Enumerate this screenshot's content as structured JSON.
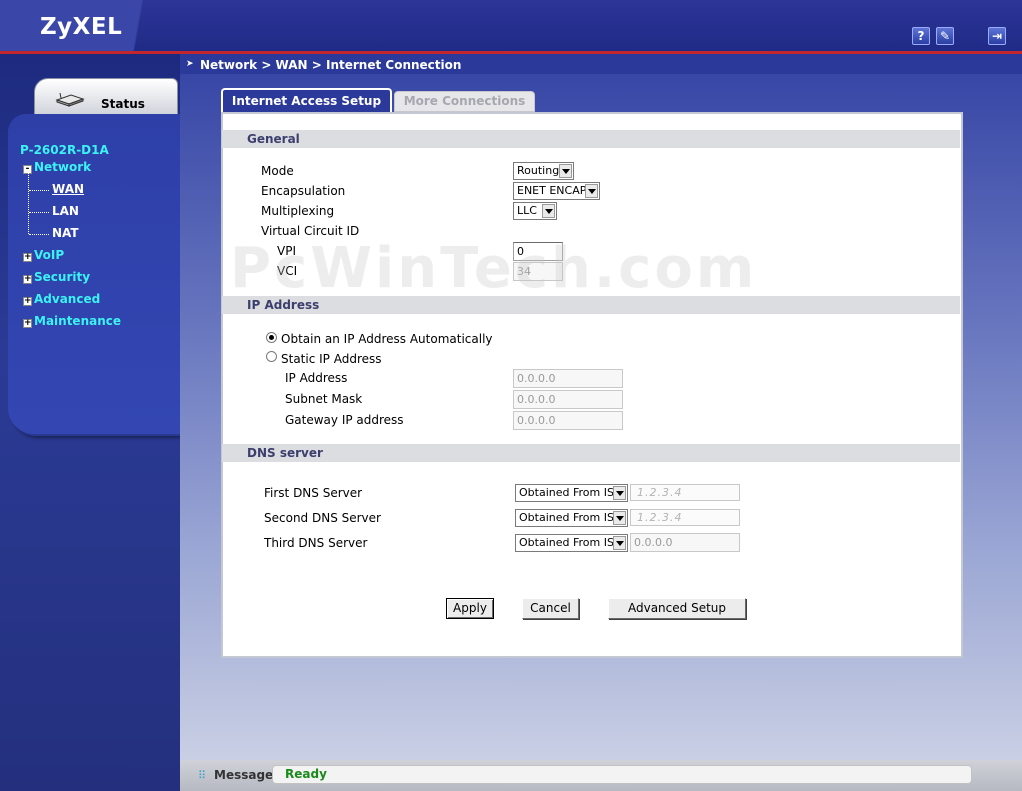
{
  "header": {
    "logo": "ZyXEL",
    "help_icon_label": "?",
    "wizard_icon_label": "✎",
    "logout_icon_label": "⇥"
  },
  "sidebar": {
    "status_label": "Status",
    "device_name": "P-2602R-D1A",
    "items": [
      {
        "label": "Network",
        "toggle": "-"
      },
      {
        "label": "WAN"
      },
      {
        "label": "LAN"
      },
      {
        "label": "NAT"
      },
      {
        "label": "VoIP",
        "toggle": "+"
      },
      {
        "label": "Security",
        "toggle": "+"
      },
      {
        "label": "Advanced",
        "toggle": "+"
      },
      {
        "label": "Maintenance",
        "toggle": "+"
      }
    ]
  },
  "breadcrumb": "Network > WAN > Internet Connection",
  "tabs": [
    {
      "label": "Internet Access Setup",
      "active": true
    },
    {
      "label": "More Connections",
      "active": false
    }
  ],
  "general": {
    "title": "General",
    "mode_label": "Mode",
    "mode_value": "Routing",
    "encapsulation_label": "Encapsulation",
    "encapsulation_value": "ENET ENCAP",
    "multiplexing_label": "Multiplexing",
    "multiplexing_value": "LLC",
    "vc_label": "Virtual Circuit ID",
    "vpi_label": "VPI",
    "vpi_value": "0",
    "vci_label": "VCI",
    "vci_value": "34"
  },
  "ip_address": {
    "title": "IP Address",
    "auto_label": "Obtain an IP Address Automatically",
    "static_label": "Static IP Address",
    "ip_label": "IP Address",
    "ip_value": "0.0.0.0",
    "subnet_label": "Subnet Mask",
    "subnet_value": "0.0.0.0",
    "gateway_label": "Gateway IP address",
    "gateway_value": "0.0.0.0",
    "selected": "auto"
  },
  "dns": {
    "title": "DNS server",
    "first_label": "First DNS Server",
    "first_value": "Obtained From ISP",
    "first_ip": "1.2.3.4",
    "second_label": "Second DNS Server",
    "second_value": "Obtained From ISP",
    "second_ip": "1.2.3.4",
    "third_label": "Third DNS Server",
    "third_value": "Obtained From ISP",
    "third_ip": "0.0.0.0"
  },
  "buttons": {
    "apply": "Apply",
    "cancel": "Cancel",
    "advanced": "Advanced Setup"
  },
  "watermark": "PcWinTech.com",
  "statusbar": {
    "label": "Message",
    "message": "Ready"
  },
  "colors": {
    "accent": "#2b3a9a",
    "nav_link": "#3cf2f2",
    "status_ok": "#1a8a1a"
  }
}
